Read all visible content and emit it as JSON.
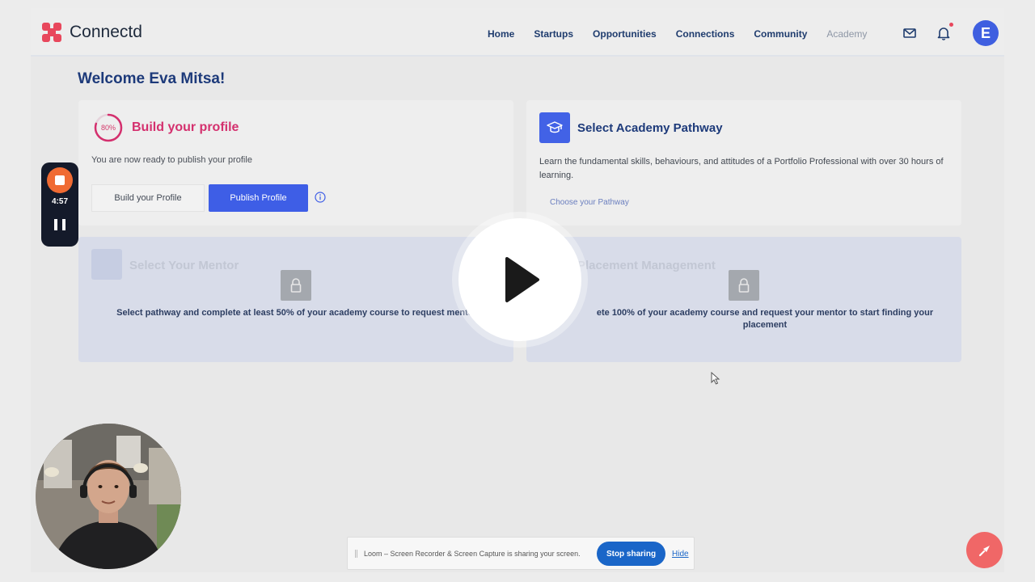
{
  "header": {
    "brand": "Connectd",
    "nav": [
      {
        "label": "Home"
      },
      {
        "label": "Startups"
      },
      {
        "label": "Opportunities"
      },
      {
        "label": "Connections"
      },
      {
        "label": "Community"
      },
      {
        "label": "Academy"
      }
    ],
    "avatar_initial": "E"
  },
  "welcome": "Welcome Eva Mitsa!",
  "profile_card": {
    "progress": "80%",
    "progress_fraction": 0.8,
    "title": "Build your profile",
    "subtitle": "You are now ready to publish your profile",
    "build_button": "Build your Profile",
    "publish_button": "Publish Profile"
  },
  "academy_card": {
    "title": "Select Academy Pathway",
    "description": "Learn the fundamental skills, behaviours, and attitudes of a Portfolio Professional with over 30 hours of learning.",
    "link": "Choose your Pathway"
  },
  "mentor_card": {
    "title": "Select Your Mentor",
    "message": "Select pathway and complete at least 50% of your academy course to request mentor"
  },
  "placement_card": {
    "title": "Placement Management",
    "message": "ete 100% of your academy course and request your mentor to start finding your placement"
  },
  "recorder": {
    "time": "4:57"
  },
  "share_bar": {
    "text": "Loom – Screen Recorder & Screen Capture is sharing your screen.",
    "stop_button": "Stop sharing",
    "hide_link": "Hide"
  },
  "colors": {
    "brand": "#e8475c",
    "primary": "#3e5ee6",
    "heading": "#1d3a7a",
    "profile_accent": "#d4306e",
    "recorder_stop": "#f06b33",
    "share_blue": "#1a66c8",
    "help_fab": "#f06767"
  }
}
